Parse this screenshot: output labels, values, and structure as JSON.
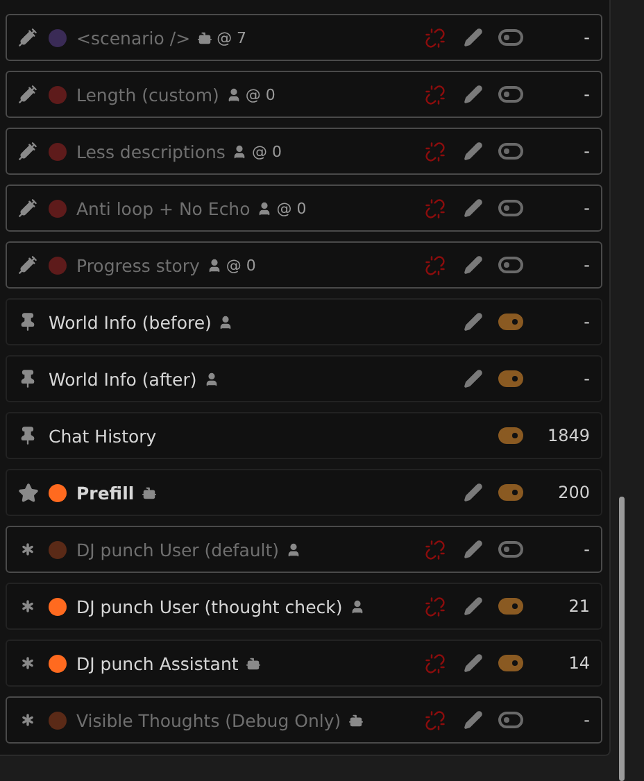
{
  "prompts": [
    {
      "kind": "injection",
      "color": "#3a2b56",
      "name": "<scenario />",
      "role": {
        "kind": "assistant"
      },
      "depth": "@ 7",
      "unlinked": true,
      "editable": true,
      "enabled": false,
      "tokens": "-"
    },
    {
      "kind": "injection",
      "color": "#5e1b1b",
      "name": "Length (custom)",
      "role": {
        "kind": "user"
      },
      "depth": "@ 0",
      "unlinked": true,
      "editable": true,
      "enabled": false,
      "tokens": "-"
    },
    {
      "kind": "injection",
      "color": "#5e1b1b",
      "name": "Less descriptions",
      "role": {
        "kind": "user"
      },
      "depth": "@ 0",
      "unlinked": true,
      "editable": true,
      "enabled": false,
      "tokens": "-"
    },
    {
      "kind": "injection",
      "color": "#5e1b1b",
      "name": "Anti loop + No Echo",
      "role": {
        "kind": "user"
      },
      "depth": "@ 0",
      "unlinked": true,
      "editable": true,
      "enabled": false,
      "tokens": "-"
    },
    {
      "kind": "injection",
      "color": "#5e1b1b",
      "name": "Progress story",
      "role": {
        "kind": "user"
      },
      "depth": "@ 0",
      "unlinked": true,
      "editable": true,
      "enabled": false,
      "tokens": "-"
    },
    {
      "kind": "marker",
      "name": "World Info (before)",
      "role": {
        "kind": "user"
      },
      "unlinked": false,
      "editable": true,
      "enabled": true,
      "tokens": "-"
    },
    {
      "kind": "marker",
      "name": "World Info (after)",
      "role": {
        "kind": "user"
      },
      "unlinked": false,
      "editable": true,
      "enabled": true,
      "tokens": "-"
    },
    {
      "kind": "marker",
      "name": "Chat History",
      "unlinked": false,
      "editable": false,
      "enabled": true,
      "tokens": "1849"
    },
    {
      "kind": "main",
      "color": "#ff6a1f",
      "name": "Prefill",
      "role": {
        "kind": "assistant"
      },
      "unlinked": false,
      "editable": true,
      "enabled": true,
      "tokens": "200"
    },
    {
      "kind": "custom",
      "color": "#5a2a17",
      "name": "DJ punch User (default)",
      "role": {
        "kind": "user"
      },
      "unlinked": true,
      "editable": true,
      "enabled": false,
      "tokens": "-"
    },
    {
      "kind": "custom",
      "color": "#ff6a1f",
      "name": "DJ punch User (thought check)",
      "role": {
        "kind": "user"
      },
      "unlinked": true,
      "editable": true,
      "enabled": true,
      "tokens": "21"
    },
    {
      "kind": "custom",
      "color": "#ff6a1f",
      "name": "DJ punch Assistant",
      "role": {
        "kind": "assistant"
      },
      "unlinked": true,
      "editable": true,
      "enabled": true,
      "tokens": "14"
    },
    {
      "kind": "custom",
      "color": "#5a2a17",
      "name": "Visible Thoughts (Debug Only)",
      "role": {
        "kind": "assistant"
      },
      "unlinked": true,
      "editable": true,
      "enabled": false,
      "tokens": "-"
    }
  ]
}
